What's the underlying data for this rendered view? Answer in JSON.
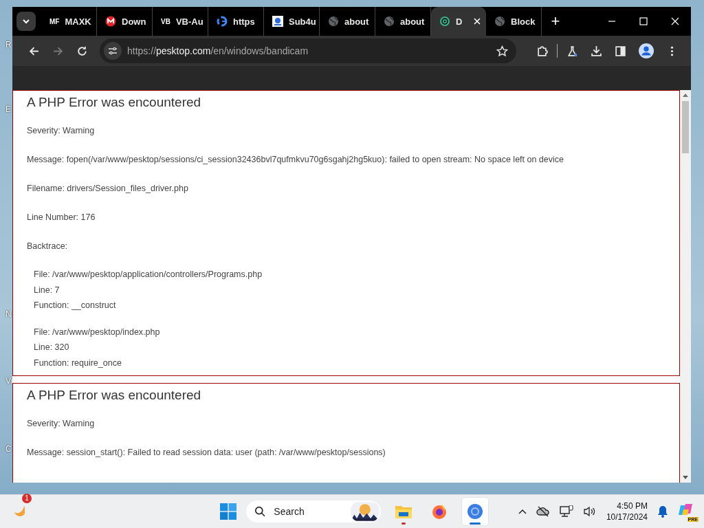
{
  "desktop": {
    "icon_labels": [
      {
        "text": "R"
      },
      {
        "text": "E"
      },
      {
        "text": "N"
      },
      {
        "text": "Vi"
      },
      {
        "text": "C"
      }
    ]
  },
  "browser": {
    "tabs": [
      {
        "kind": "letters",
        "icon_text": "MF",
        "title": "MAXK",
        "selected": false
      },
      {
        "kind": "red",
        "title": "Down",
        "selected": false
      },
      {
        "kind": "letters",
        "icon_text": "VB",
        "title": "VB-Au",
        "selected": false
      },
      {
        "kind": "google",
        "title": "https",
        "selected": false
      },
      {
        "kind": "square",
        "title": "Sub4u",
        "selected": false
      },
      {
        "kind": "globe",
        "title": "about",
        "selected": false
      },
      {
        "kind": "globe",
        "title": "about",
        "selected": false
      },
      {
        "kind": "ring",
        "title": "D",
        "selected": true
      },
      {
        "kind": "globe",
        "title": "Block",
        "selected": false
      }
    ],
    "new_tab": "+",
    "address": {
      "scheme": "https://",
      "host": "pesktop.com",
      "path": "/en/windows/bandicam"
    }
  },
  "errors": [
    {
      "heading": "A PHP Error was encountered",
      "lines": [
        "Severity: Warning",
        "Message: fopen(/var/www/pesktop/sessions/ci_session32436bvl7qufmkvu70g6sgahj2hg5kuo): failed to open stream: No space left on device",
        "Filename: drivers/Session_files_driver.php",
        "Line Number: 176",
        "Backtrace:"
      ],
      "backtrace": [
        [
          "File: /var/www/pesktop/application/controllers/Programs.php",
          "Line: 7",
          "Function: __construct"
        ],
        [
          "File: /var/www/pesktop/index.php",
          "Line: 320",
          "Function: require_once"
        ]
      ]
    },
    {
      "heading": "A PHP Error was encountered",
      "lines": [
        "Severity: Warning",
        "Message: session_start(): Failed to read session data: user (path: /var/www/pesktop/sessions)"
      ]
    }
  ],
  "taskbar": {
    "weather_badge": "1",
    "search": {
      "placeholder": "Search"
    },
    "apps": [
      {
        "kind": "folder",
        "running": true,
        "active": false
      },
      {
        "kind": "firefox",
        "running": false,
        "active": false
      },
      {
        "kind": "chrome",
        "running": true,
        "active": true
      }
    ],
    "time": "4:50 PM",
    "date": "10/17/2024",
    "copilot_badge": "PRE"
  }
}
